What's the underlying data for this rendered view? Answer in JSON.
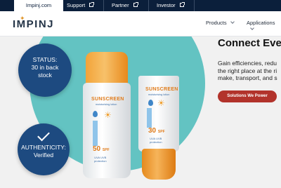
{
  "topbar": {
    "tabs": [
      {
        "label": "Impinj.com",
        "active": true,
        "external": false
      },
      {
        "label": "Support",
        "active": false,
        "external": true
      },
      {
        "label": "Partner",
        "active": false,
        "external": true
      },
      {
        "label": "Investor",
        "active": false,
        "external": true
      }
    ]
  },
  "nav": {
    "logo": "IMPINJ",
    "menu": [
      {
        "label": "Products",
        "icon": "chevron-down-icon"
      },
      {
        "label": "Applications",
        "icon": "chevron-down-icon"
      }
    ]
  },
  "hero": {
    "status_badge": "STATUS: 30 in back stock",
    "status_lines": [
      "STATUS:",
      "30 in back",
      "stock"
    ],
    "authenticity_lines": [
      "AUTHENTICITY:",
      "Verified"
    ],
    "headline": "Connect Eve",
    "body_lines": [
      "Gain efficiencies, redu",
      "the right place at the ri",
      "make, transport, and s"
    ],
    "cta_label": "Solutions We Power",
    "product_large": {
      "title": "SUNSCREEN",
      "subtitle": "moisturising lotion",
      "spf": "50",
      "spf_unit": "SPF",
      "uv_lines": [
        "UVA UVB",
        "protection"
      ]
    },
    "product_small": {
      "title": "SUNSCREEN",
      "subtitle": "moisturising lotion",
      "spf": "30",
      "spf_unit": "SPF",
      "uv_lines": [
        "UVA UVB",
        "protection"
      ]
    }
  },
  "colors": {
    "topbar": "#0b1f3b",
    "teal_circle": "#63c3c2",
    "badge": "#1d4a80",
    "cta": "#b2332b",
    "orange": "#e07b1a"
  }
}
